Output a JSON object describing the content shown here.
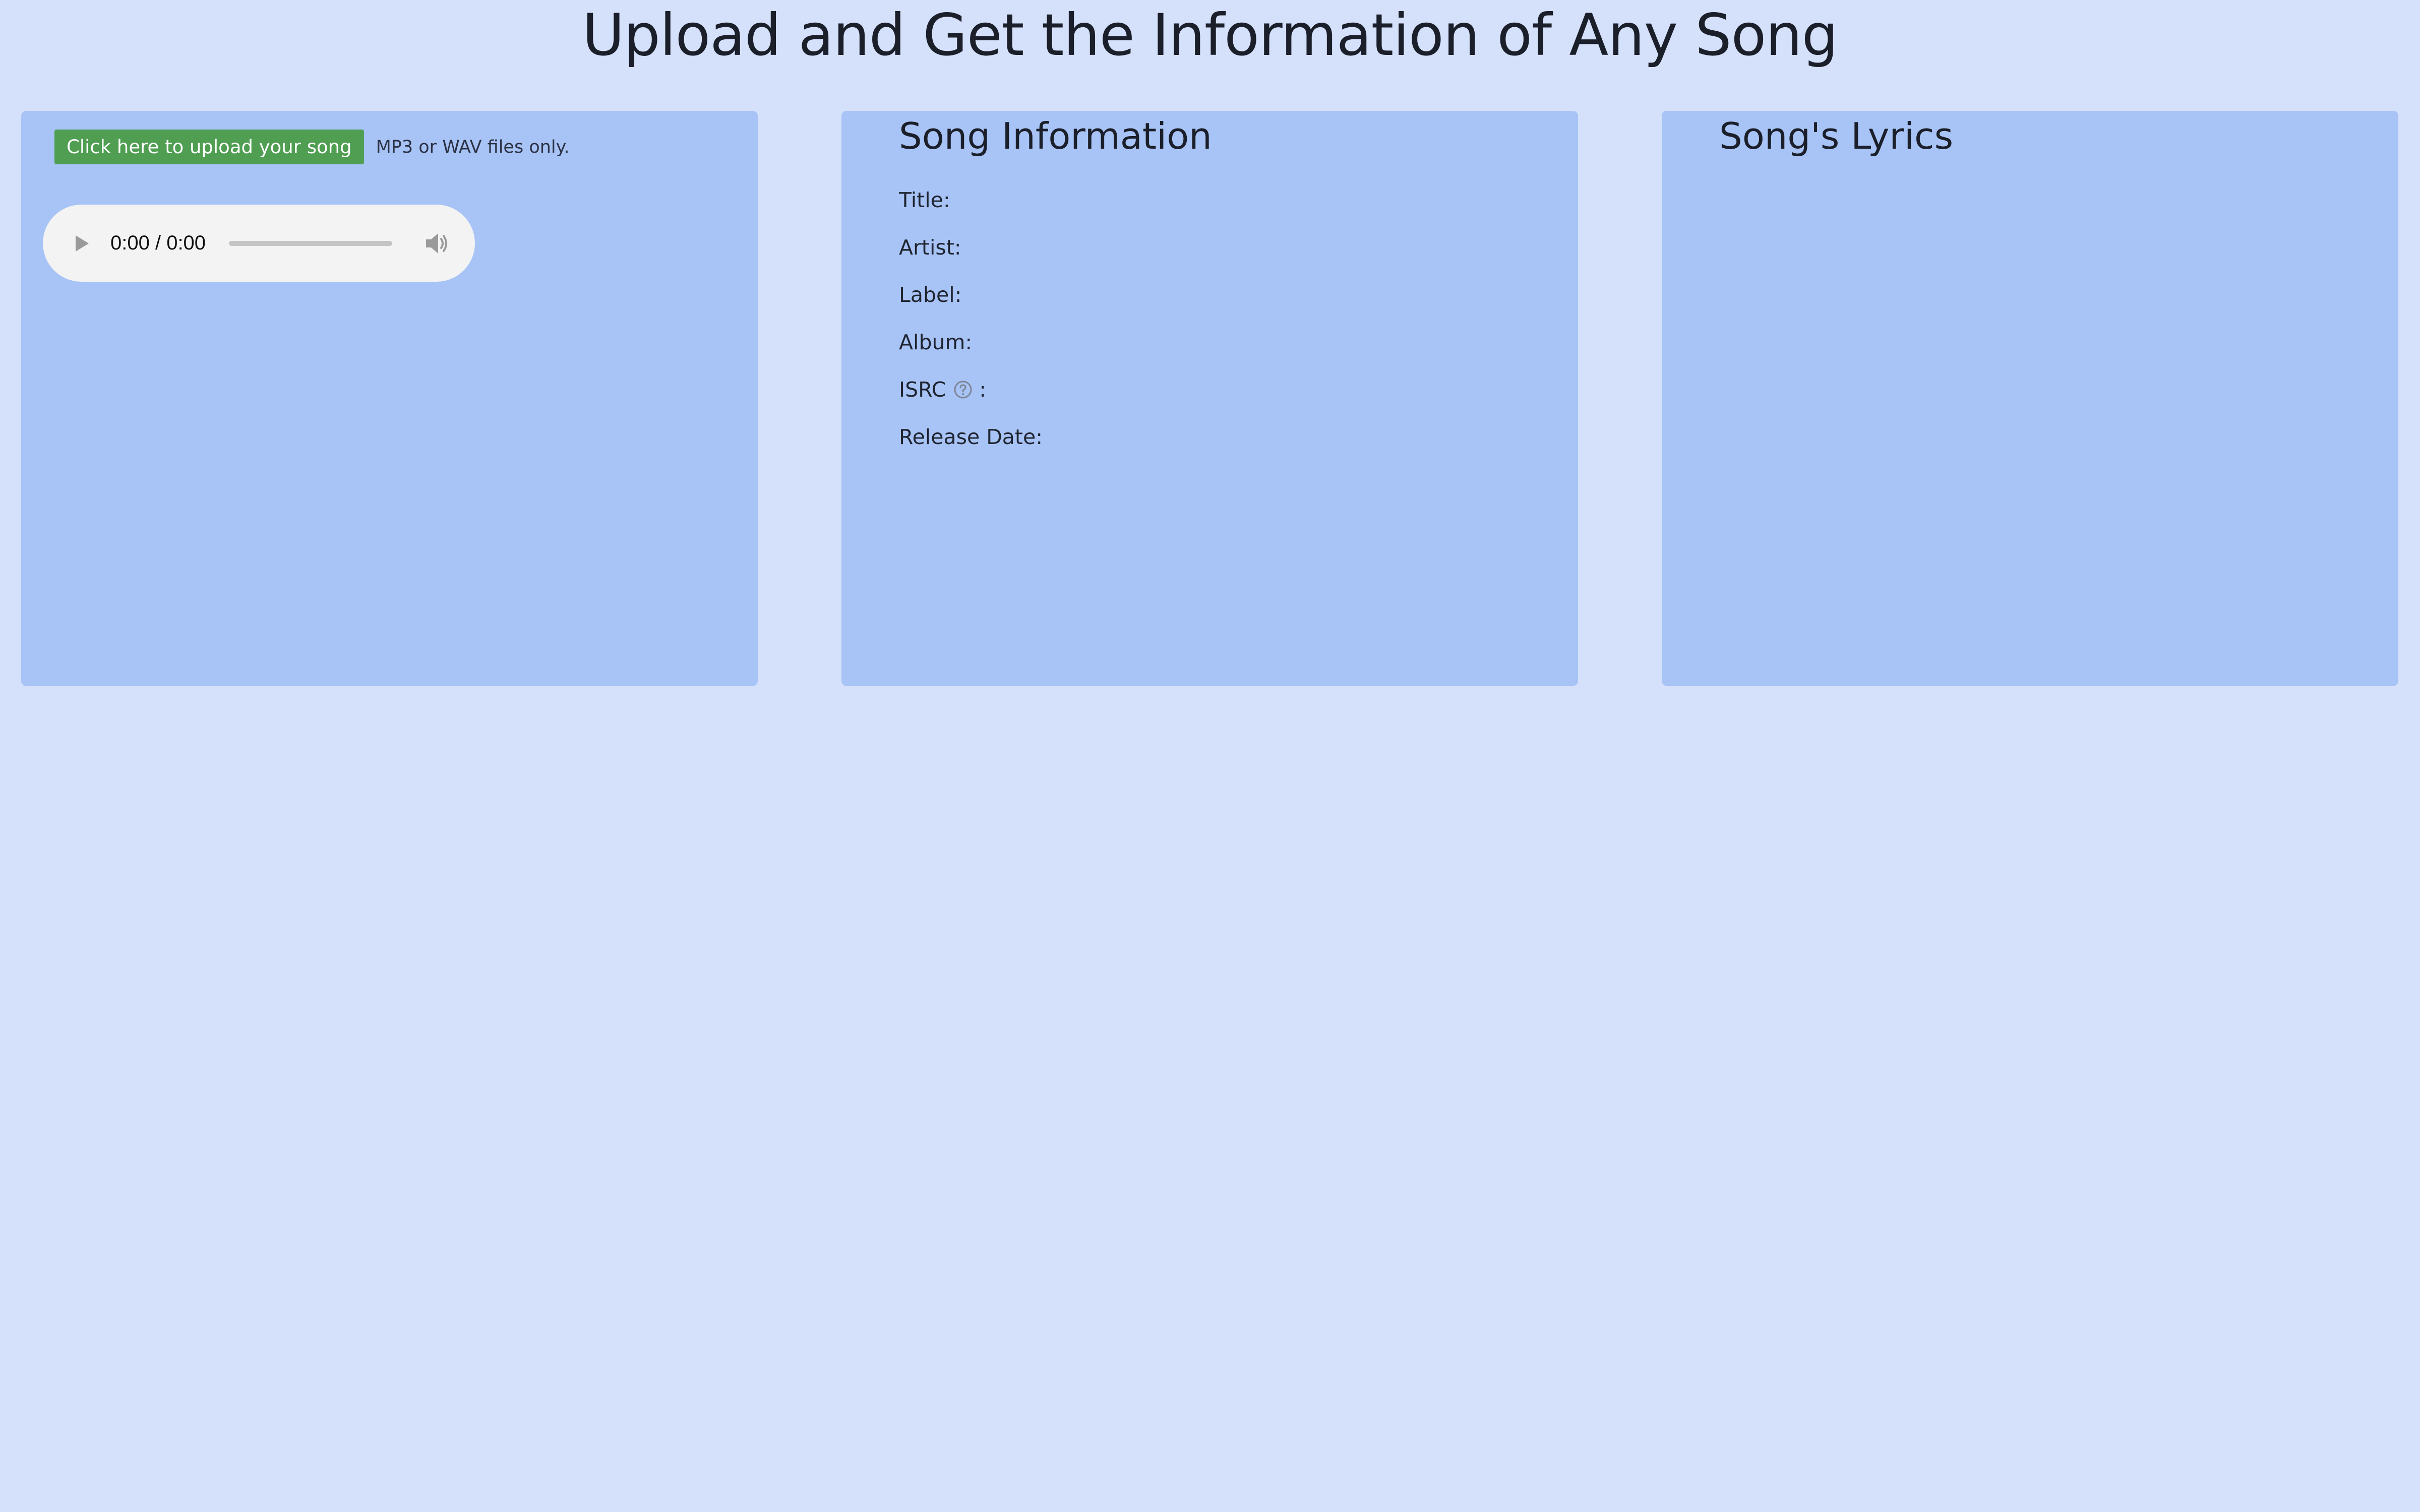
{
  "page": {
    "title": "Upload and Get the Information of Any Song"
  },
  "upload_panel": {
    "button_label": "Click here to upload your song",
    "hint": "MP3 or WAV files only.",
    "player": {
      "time": "0:00 / 0:00",
      "progress_fraction": 0,
      "play_icon": "play-icon",
      "volume_icon": "volume-icon"
    }
  },
  "info_panel": {
    "heading": "Song Information",
    "fields": {
      "title": {
        "label": "Title:",
        "value": ""
      },
      "artist": {
        "label": "Artist:",
        "value": ""
      },
      "label": {
        "label": "Label:",
        "value": ""
      },
      "album": {
        "label": "Album:",
        "value": ""
      },
      "isrc": {
        "label": "ISRC",
        "suffix": ":",
        "value": "",
        "help_icon": "question-circle-icon"
      },
      "release_date": {
        "label": "Release Date:",
        "value": ""
      }
    }
  },
  "lyrics_panel": {
    "heading": "Song's Lyrics",
    "lyrics": ""
  },
  "colors": {
    "page_background": "#d5e0fa",
    "panel_background": "#a8c4f6",
    "button_green": "#4f9e52",
    "player_background": "#f3f3f3"
  }
}
